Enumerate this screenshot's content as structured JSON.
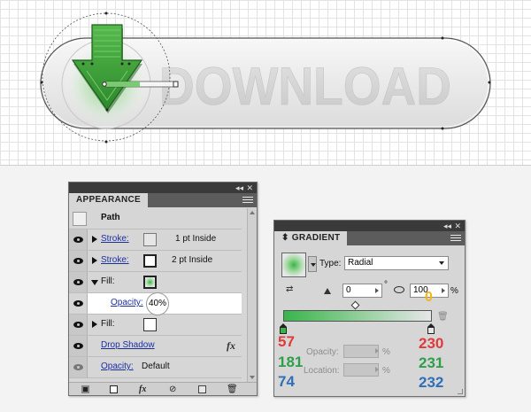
{
  "artboard": {
    "button_text": "DOWNLOAD",
    "colors": {
      "arrow_green": "#3aa836",
      "arrow_dark": "#2a7a28",
      "glow": "#8fd38a",
      "button_fill": "#ebebeb",
      "text_fill": "#d4d4d4"
    }
  },
  "appearance": {
    "tab": "APPEARANCE",
    "header": {
      "label": "Path"
    },
    "rows": [
      {
        "label": "Stroke:",
        "value": "1 pt  Inside",
        "visible": true
      },
      {
        "label": "Stroke:",
        "value": "2 pt  Inside",
        "visible": true
      },
      {
        "label": "Fill:",
        "expanded": true,
        "visible": true
      },
      {
        "label": "Opacity:",
        "value": "40%",
        "highlight": true
      },
      {
        "label": "Fill:",
        "visible": true
      },
      {
        "label": "Drop Shadow",
        "fx": "fx",
        "visible": true
      },
      {
        "label": "Opacity:",
        "value": "Default",
        "visible": true
      }
    ],
    "footer_icons": [
      "new-stroke-icon",
      "new-fill-icon",
      "add-effect-icon",
      "clear-appearance-icon",
      "duplicate-item-icon",
      "delete-item-icon"
    ]
  },
  "gradient": {
    "tab": "GRADIENT",
    "type_label": "Type:",
    "type_value": "Radial",
    "angle_value": "0",
    "degree_symbol": "°",
    "aspect_value": "100",
    "percent_symbol": "%",
    "annotation_zero": "0",
    "opacity_label": "Opacity:",
    "location_label": "Location:",
    "left_stop_rgb": [
      "57",
      "181",
      "74"
    ],
    "right_stop_rgb": [
      "230",
      "231",
      "232"
    ],
    "colors": {
      "red": "#e03a3a",
      "green": "#2f9e4a",
      "blue": "#2f6fb8",
      "orange": "#f5b418",
      "ramp_start": "#39b54a",
      "ramp_end": "#e6e7e8"
    }
  }
}
